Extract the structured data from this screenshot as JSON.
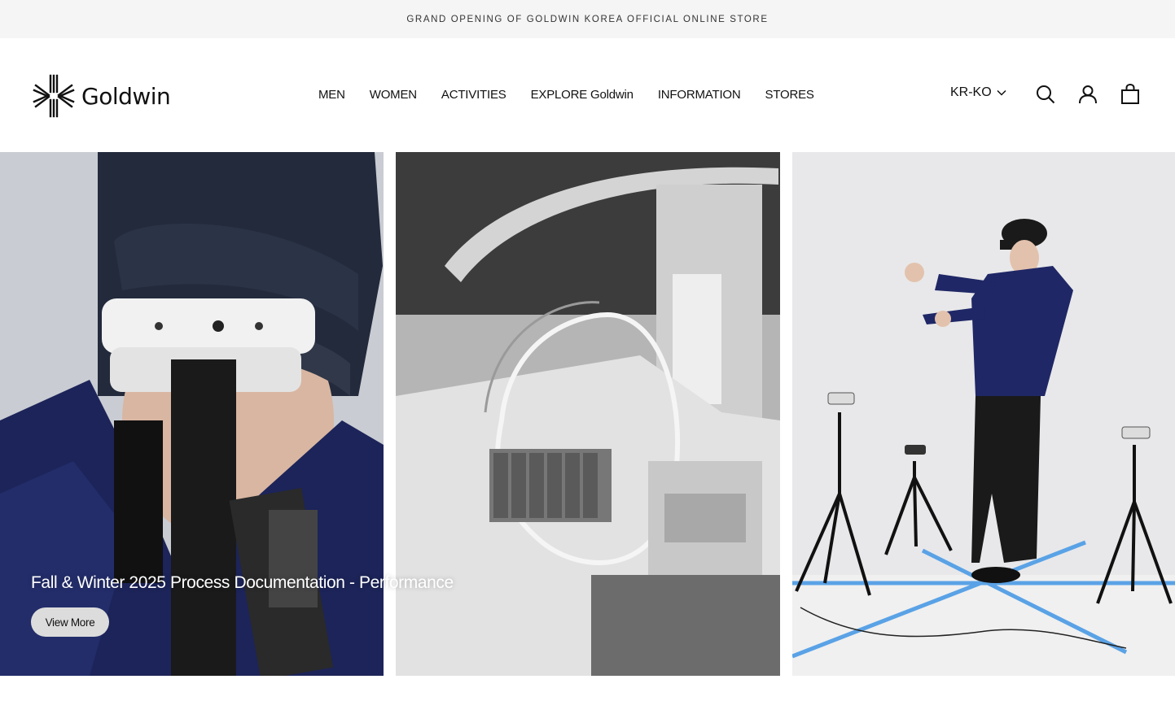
{
  "announcement": {
    "text": "GRAND OPENING OF GOLDWIN KOREA OFFICIAL ONLINE STORE"
  },
  "header": {
    "logo_text": "Goldwin",
    "nav": [
      {
        "label": "MEN"
      },
      {
        "label": "WOMEN"
      },
      {
        "label": "ACTIVITIES"
      },
      {
        "label": "EXPLORE Goldwin"
      },
      {
        "label": "INFORMATION"
      },
      {
        "label": "STORES"
      }
    ],
    "locale": "KR-KO",
    "icons": {
      "search": "search-icon",
      "account": "account-icon",
      "cart": "cart-icon",
      "locale_dropdown": "chevron-down-icon"
    }
  },
  "hero": {
    "title": "Fall & Winter 2025 Process Documentation - Performance",
    "button_label": "View More",
    "panels": [
      {
        "name": "model-behind-camera-photo"
      },
      {
        "name": "machinery-tubes-photo"
      },
      {
        "name": "model-with-tripods-photo"
      }
    ]
  },
  "colors": {
    "navy": "#1c2459",
    "announce_bg": "#f5f5f5",
    "floor_tape": "#5aa2e6"
  }
}
